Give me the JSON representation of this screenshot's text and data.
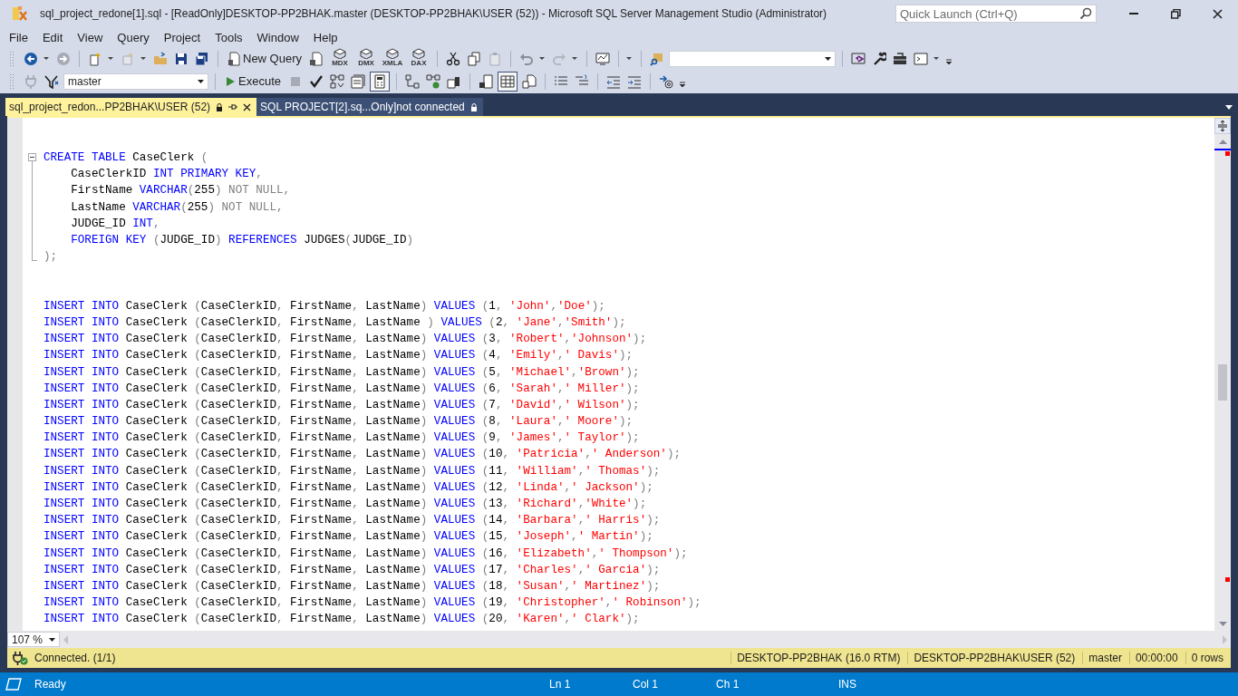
{
  "window": {
    "title": "sql_project_redone[1].sql -  [ReadOnly]DESKTOP-PP2BHAK.master (DESKTOP-PP2BHAK\\USER (52)) - Microsoft SQL Server Management Studio (Administrator)"
  },
  "quick_launch": {
    "placeholder": "Quick Launch (Ctrl+Q)"
  },
  "menu": [
    "File",
    "Edit",
    "View",
    "Query",
    "Project",
    "Tools",
    "Window",
    "Help"
  ],
  "toolbar": {
    "new_query": "New Query",
    "query_types": [
      "MDX",
      "DMX",
      "XMLA",
      "DAX"
    ],
    "database": "master",
    "execute": "Execute"
  },
  "tabs": [
    {
      "label": "sql_project_redon...PP2BHAK\\USER (52)",
      "selected": true
    },
    {
      "label": "SQL PROJECT[2].sq...Only]not connected",
      "selected": false
    }
  ],
  "editor": {
    "lines": [
      {
        "kind": "fold_start",
        "tokens": [
          {
            "kind": "keyword",
            "text": "CREATE TABLE"
          },
          {
            "kind": "name",
            "text": " CaseClerk "
          },
          {
            "kind": "punct",
            "text": "("
          }
        ]
      },
      {
        "kind": "fold_inside",
        "tokens": [
          {
            "kind": "name",
            "text": "    CaseClerkID "
          },
          {
            "kind": "keyword",
            "text": "INT PRIMARY KEY"
          },
          {
            "kind": "punct",
            "text": ","
          }
        ]
      },
      {
        "kind": "fold_inside",
        "tokens": [
          {
            "kind": "name",
            "text": "    FirstName "
          },
          {
            "kind": "keyword",
            "text": "VARCHAR"
          },
          {
            "kind": "punct",
            "text": "("
          },
          {
            "kind": "name",
            "text": "255"
          },
          {
            "kind": "punct",
            "text": ") NOT NULL,"
          }
        ]
      },
      {
        "kind": "fold_inside",
        "tokens": [
          {
            "kind": "name",
            "text": "    LastName "
          },
          {
            "kind": "keyword",
            "text": "VARCHAR"
          },
          {
            "kind": "punct",
            "text": "("
          },
          {
            "kind": "name",
            "text": "255"
          },
          {
            "kind": "punct",
            "text": ") NOT NULL,"
          }
        ]
      },
      {
        "kind": "fold_inside",
        "tokens": [
          {
            "kind": "name",
            "text": "    JUDGE_ID "
          },
          {
            "kind": "keyword",
            "text": "INT"
          },
          {
            "kind": "punct",
            "text": ","
          }
        ]
      },
      {
        "kind": "fold_inside",
        "tokens": [
          {
            "kind": "keyword",
            "text": "    FOREIGN KEY"
          },
          {
            "kind": "punct",
            "text": " ("
          },
          {
            "kind": "name",
            "text": "JUDGE_ID"
          },
          {
            "kind": "punct",
            "text": ") "
          },
          {
            "kind": "keyword",
            "text": "REFERENCES"
          },
          {
            "kind": "name",
            "text": " JUDGES"
          },
          {
            "kind": "punct",
            "text": "("
          },
          {
            "kind": "name",
            "text": "JUDGE_ID"
          },
          {
            "kind": "punct",
            "text": ")"
          }
        ]
      },
      {
        "kind": "fold_end",
        "tokens": [
          {
            "kind": "punct",
            "text": ");"
          }
        ]
      },
      {
        "kind": "blank"
      },
      {
        "kind": "blank"
      },
      {
        "kind": "code",
        "tokens": [
          {
            "kind": "keyword",
            "text": "INSERT INTO"
          },
          {
            "kind": "name",
            "text": " CaseClerk "
          },
          {
            "kind": "punct",
            "text": "("
          },
          {
            "kind": "name",
            "text": "CaseClerkID"
          },
          {
            "kind": "punct",
            "text": ", "
          },
          {
            "kind": "name",
            "text": "FirstName"
          },
          {
            "kind": "punct",
            "text": ", "
          },
          {
            "kind": "name",
            "text": "LastName"
          },
          {
            "kind": "punct",
            "text": ") "
          },
          {
            "kind": "keyword",
            "text": "VALUES"
          },
          {
            "kind": "punct",
            "text": " ("
          },
          {
            "kind": "name",
            "text": "1"
          },
          {
            "kind": "punct",
            "text": ", "
          },
          {
            "kind": "string",
            "text": "'John'"
          },
          {
            "kind": "punct",
            "text": ","
          },
          {
            "kind": "string",
            "text": "'Doe'"
          },
          {
            "kind": "punct",
            "text": ");"
          }
        ]
      },
      {
        "kind": "code",
        "tokens": [
          {
            "kind": "keyword",
            "text": "INSERT INTO"
          },
          {
            "kind": "name",
            "text": " CaseClerk "
          },
          {
            "kind": "punct",
            "text": "("
          },
          {
            "kind": "name",
            "text": "CaseClerkID"
          },
          {
            "kind": "punct",
            "text": ", "
          },
          {
            "kind": "name",
            "text": "FirstName"
          },
          {
            "kind": "punct",
            "text": ", "
          },
          {
            "kind": "name",
            "text": "LastName"
          },
          {
            "kind": "punct",
            "text": " ) "
          },
          {
            "kind": "keyword",
            "text": "VALUES"
          },
          {
            "kind": "punct",
            "text": " ("
          },
          {
            "kind": "name",
            "text": "2"
          },
          {
            "kind": "punct",
            "text": ", "
          },
          {
            "kind": "string",
            "text": "'Jane'"
          },
          {
            "kind": "punct",
            "text": ","
          },
          {
            "kind": "string",
            "text": "'Smith'"
          },
          {
            "kind": "punct",
            "text": ");"
          }
        ]
      },
      {
        "kind": "code",
        "tokens": [
          {
            "kind": "keyword",
            "text": "INSERT INTO"
          },
          {
            "kind": "name",
            "text": " CaseClerk "
          },
          {
            "kind": "punct",
            "text": "("
          },
          {
            "kind": "name",
            "text": "CaseClerkID"
          },
          {
            "kind": "punct",
            "text": ", "
          },
          {
            "kind": "name",
            "text": "FirstName"
          },
          {
            "kind": "punct",
            "text": ", "
          },
          {
            "kind": "name",
            "text": "LastName"
          },
          {
            "kind": "punct",
            "text": ") "
          },
          {
            "kind": "keyword",
            "text": "VALUES"
          },
          {
            "kind": "punct",
            "text": " ("
          },
          {
            "kind": "name",
            "text": "3"
          },
          {
            "kind": "punct",
            "text": ", "
          },
          {
            "kind": "string",
            "text": "'Robert'"
          },
          {
            "kind": "punct",
            "text": ","
          },
          {
            "kind": "string",
            "text": "'Johnson'"
          },
          {
            "kind": "punct",
            "text": ");"
          }
        ]
      },
      {
        "kind": "code",
        "tokens": [
          {
            "kind": "keyword",
            "text": "INSERT INTO"
          },
          {
            "kind": "name",
            "text": " CaseClerk "
          },
          {
            "kind": "punct",
            "text": "("
          },
          {
            "kind": "name",
            "text": "CaseClerkID"
          },
          {
            "kind": "punct",
            "text": ", "
          },
          {
            "kind": "name",
            "text": "FirstName"
          },
          {
            "kind": "punct",
            "text": ", "
          },
          {
            "kind": "name",
            "text": "LastName"
          },
          {
            "kind": "punct",
            "text": ") "
          },
          {
            "kind": "keyword",
            "text": "VALUES"
          },
          {
            "kind": "punct",
            "text": " ("
          },
          {
            "kind": "name",
            "text": "4"
          },
          {
            "kind": "punct",
            "text": ", "
          },
          {
            "kind": "string",
            "text": "'Emily'"
          },
          {
            "kind": "punct",
            "text": ","
          },
          {
            "kind": "string",
            "text": "' Davis'"
          },
          {
            "kind": "punct",
            "text": ");"
          }
        ]
      },
      {
        "kind": "code",
        "tokens": [
          {
            "kind": "keyword",
            "text": "INSERT INTO"
          },
          {
            "kind": "name",
            "text": " CaseClerk "
          },
          {
            "kind": "punct",
            "text": "("
          },
          {
            "kind": "name",
            "text": "CaseClerkID"
          },
          {
            "kind": "punct",
            "text": ", "
          },
          {
            "kind": "name",
            "text": "FirstName"
          },
          {
            "kind": "punct",
            "text": ", "
          },
          {
            "kind": "name",
            "text": "LastName"
          },
          {
            "kind": "punct",
            "text": ") "
          },
          {
            "kind": "keyword",
            "text": "VALUES"
          },
          {
            "kind": "punct",
            "text": " ("
          },
          {
            "kind": "name",
            "text": "5"
          },
          {
            "kind": "punct",
            "text": ", "
          },
          {
            "kind": "string",
            "text": "'Michael'"
          },
          {
            "kind": "punct",
            "text": ","
          },
          {
            "kind": "string",
            "text": "'Brown'"
          },
          {
            "kind": "punct",
            "text": ");"
          }
        ]
      },
      {
        "kind": "code",
        "tokens": [
          {
            "kind": "keyword",
            "text": "INSERT INTO"
          },
          {
            "kind": "name",
            "text": " CaseClerk "
          },
          {
            "kind": "punct",
            "text": "("
          },
          {
            "kind": "name",
            "text": "CaseClerkID"
          },
          {
            "kind": "punct",
            "text": ", "
          },
          {
            "kind": "name",
            "text": "FirstName"
          },
          {
            "kind": "punct",
            "text": ", "
          },
          {
            "kind": "name",
            "text": "LastName"
          },
          {
            "kind": "punct",
            "text": ") "
          },
          {
            "kind": "keyword",
            "text": "VALUES"
          },
          {
            "kind": "punct",
            "text": " ("
          },
          {
            "kind": "name",
            "text": "6"
          },
          {
            "kind": "punct",
            "text": ", "
          },
          {
            "kind": "string",
            "text": "'Sarah'"
          },
          {
            "kind": "punct",
            "text": ","
          },
          {
            "kind": "string",
            "text": "' Miller'"
          },
          {
            "kind": "punct",
            "text": ");"
          }
        ]
      },
      {
        "kind": "code",
        "tokens": [
          {
            "kind": "keyword",
            "text": "INSERT INTO"
          },
          {
            "kind": "name",
            "text": " CaseClerk "
          },
          {
            "kind": "punct",
            "text": "("
          },
          {
            "kind": "name",
            "text": "CaseClerkID"
          },
          {
            "kind": "punct",
            "text": ", "
          },
          {
            "kind": "name",
            "text": "FirstName"
          },
          {
            "kind": "punct",
            "text": ", "
          },
          {
            "kind": "name",
            "text": "LastName"
          },
          {
            "kind": "punct",
            "text": ") "
          },
          {
            "kind": "keyword",
            "text": "VALUES"
          },
          {
            "kind": "punct",
            "text": " ("
          },
          {
            "kind": "name",
            "text": "7"
          },
          {
            "kind": "punct",
            "text": ", "
          },
          {
            "kind": "string",
            "text": "'David'"
          },
          {
            "kind": "punct",
            "text": ","
          },
          {
            "kind": "string",
            "text": "' Wilson'"
          },
          {
            "kind": "punct",
            "text": ");"
          }
        ]
      },
      {
        "kind": "code",
        "tokens": [
          {
            "kind": "keyword",
            "text": "INSERT INTO"
          },
          {
            "kind": "name",
            "text": " CaseClerk "
          },
          {
            "kind": "punct",
            "text": "("
          },
          {
            "kind": "name",
            "text": "CaseClerkID"
          },
          {
            "kind": "punct",
            "text": ", "
          },
          {
            "kind": "name",
            "text": "FirstName"
          },
          {
            "kind": "punct",
            "text": ", "
          },
          {
            "kind": "name",
            "text": "LastName"
          },
          {
            "kind": "punct",
            "text": ") "
          },
          {
            "kind": "keyword",
            "text": "VALUES"
          },
          {
            "kind": "punct",
            "text": " ("
          },
          {
            "kind": "name",
            "text": "8"
          },
          {
            "kind": "punct",
            "text": ", "
          },
          {
            "kind": "string",
            "text": "'Laura'"
          },
          {
            "kind": "punct",
            "text": ","
          },
          {
            "kind": "string",
            "text": "' Moore'"
          },
          {
            "kind": "punct",
            "text": ");"
          }
        ]
      },
      {
        "kind": "code",
        "tokens": [
          {
            "kind": "keyword",
            "text": "INSERT INTO"
          },
          {
            "kind": "name",
            "text": " CaseClerk "
          },
          {
            "kind": "punct",
            "text": "("
          },
          {
            "kind": "name",
            "text": "CaseClerkID"
          },
          {
            "kind": "punct",
            "text": ", "
          },
          {
            "kind": "name",
            "text": "FirstName"
          },
          {
            "kind": "punct",
            "text": ", "
          },
          {
            "kind": "name",
            "text": "LastName"
          },
          {
            "kind": "punct",
            "text": ") "
          },
          {
            "kind": "keyword",
            "text": "VALUES"
          },
          {
            "kind": "punct",
            "text": " ("
          },
          {
            "kind": "name",
            "text": "9"
          },
          {
            "kind": "punct",
            "text": ", "
          },
          {
            "kind": "string",
            "text": "'James'"
          },
          {
            "kind": "punct",
            "text": ","
          },
          {
            "kind": "string",
            "text": "' Taylor'"
          },
          {
            "kind": "punct",
            "text": ");"
          }
        ]
      },
      {
        "kind": "code",
        "tokens": [
          {
            "kind": "keyword",
            "text": "INSERT INTO"
          },
          {
            "kind": "name",
            "text": " CaseClerk "
          },
          {
            "kind": "punct",
            "text": "("
          },
          {
            "kind": "name",
            "text": "CaseClerkID"
          },
          {
            "kind": "punct",
            "text": ", "
          },
          {
            "kind": "name",
            "text": "FirstName"
          },
          {
            "kind": "punct",
            "text": ", "
          },
          {
            "kind": "name",
            "text": "LastName"
          },
          {
            "kind": "punct",
            "text": ") "
          },
          {
            "kind": "keyword",
            "text": "VALUES"
          },
          {
            "kind": "punct",
            "text": " ("
          },
          {
            "kind": "name",
            "text": "10"
          },
          {
            "kind": "punct",
            "text": ", "
          },
          {
            "kind": "string",
            "text": "'Patricia'"
          },
          {
            "kind": "punct",
            "text": ","
          },
          {
            "kind": "string",
            "text": "' Anderson'"
          },
          {
            "kind": "punct",
            "text": ");"
          }
        ]
      },
      {
        "kind": "code",
        "tokens": [
          {
            "kind": "keyword",
            "text": "INSERT INTO"
          },
          {
            "kind": "name",
            "text": " CaseClerk "
          },
          {
            "kind": "punct",
            "text": "("
          },
          {
            "kind": "name",
            "text": "CaseClerkID"
          },
          {
            "kind": "punct",
            "text": ", "
          },
          {
            "kind": "name",
            "text": "FirstName"
          },
          {
            "kind": "punct",
            "text": ", "
          },
          {
            "kind": "name",
            "text": "LastName"
          },
          {
            "kind": "punct",
            "text": ") "
          },
          {
            "kind": "keyword",
            "text": "VALUES"
          },
          {
            "kind": "punct",
            "text": " ("
          },
          {
            "kind": "name",
            "text": "11"
          },
          {
            "kind": "punct",
            "text": ", "
          },
          {
            "kind": "string",
            "text": "'William'"
          },
          {
            "kind": "punct",
            "text": ","
          },
          {
            "kind": "string",
            "text": "' Thomas'"
          },
          {
            "kind": "punct",
            "text": ");"
          }
        ]
      },
      {
        "kind": "code",
        "tokens": [
          {
            "kind": "keyword",
            "text": "INSERT INTO"
          },
          {
            "kind": "name",
            "text": " CaseClerk "
          },
          {
            "kind": "punct",
            "text": "("
          },
          {
            "kind": "name",
            "text": "CaseClerkID"
          },
          {
            "kind": "punct",
            "text": ", "
          },
          {
            "kind": "name",
            "text": "FirstName"
          },
          {
            "kind": "punct",
            "text": ", "
          },
          {
            "kind": "name",
            "text": "LastName"
          },
          {
            "kind": "punct",
            "text": ") "
          },
          {
            "kind": "keyword",
            "text": "VALUES"
          },
          {
            "kind": "punct",
            "text": " ("
          },
          {
            "kind": "name",
            "text": "12"
          },
          {
            "kind": "punct",
            "text": ", "
          },
          {
            "kind": "string",
            "text": "'Linda'"
          },
          {
            "kind": "punct",
            "text": ","
          },
          {
            "kind": "string",
            "text": "' Jackson'"
          },
          {
            "kind": "punct",
            "text": ");"
          }
        ]
      },
      {
        "kind": "code",
        "tokens": [
          {
            "kind": "keyword",
            "text": "INSERT INTO"
          },
          {
            "kind": "name",
            "text": " CaseClerk "
          },
          {
            "kind": "punct",
            "text": "("
          },
          {
            "kind": "name",
            "text": "CaseClerkID"
          },
          {
            "kind": "punct",
            "text": ", "
          },
          {
            "kind": "name",
            "text": "FirstName"
          },
          {
            "kind": "punct",
            "text": ", "
          },
          {
            "kind": "name",
            "text": "LastName"
          },
          {
            "kind": "punct",
            "text": ") "
          },
          {
            "kind": "keyword",
            "text": "VALUES"
          },
          {
            "kind": "punct",
            "text": " ("
          },
          {
            "kind": "name",
            "text": "13"
          },
          {
            "kind": "punct",
            "text": ", "
          },
          {
            "kind": "string",
            "text": "'Richard'"
          },
          {
            "kind": "punct",
            "text": ","
          },
          {
            "kind": "string",
            "text": "'White'"
          },
          {
            "kind": "punct",
            "text": ");"
          }
        ]
      },
      {
        "kind": "code",
        "tokens": [
          {
            "kind": "keyword",
            "text": "INSERT INTO"
          },
          {
            "kind": "name",
            "text": " CaseClerk "
          },
          {
            "kind": "punct",
            "text": "("
          },
          {
            "kind": "name",
            "text": "CaseClerkID"
          },
          {
            "kind": "punct",
            "text": ", "
          },
          {
            "kind": "name",
            "text": "FirstName"
          },
          {
            "kind": "punct",
            "text": ", "
          },
          {
            "kind": "name",
            "text": "LastName"
          },
          {
            "kind": "punct",
            "text": ") "
          },
          {
            "kind": "keyword",
            "text": "VALUES"
          },
          {
            "kind": "punct",
            "text": " ("
          },
          {
            "kind": "name",
            "text": "14"
          },
          {
            "kind": "punct",
            "text": ", "
          },
          {
            "kind": "string",
            "text": "'Barbara'"
          },
          {
            "kind": "punct",
            "text": ","
          },
          {
            "kind": "string",
            "text": "' Harris'"
          },
          {
            "kind": "punct",
            "text": ");"
          }
        ]
      },
      {
        "kind": "code",
        "tokens": [
          {
            "kind": "keyword",
            "text": "INSERT INTO"
          },
          {
            "kind": "name",
            "text": " CaseClerk "
          },
          {
            "kind": "punct",
            "text": "("
          },
          {
            "kind": "name",
            "text": "CaseClerkID"
          },
          {
            "kind": "punct",
            "text": ", "
          },
          {
            "kind": "name",
            "text": "FirstName"
          },
          {
            "kind": "punct",
            "text": ", "
          },
          {
            "kind": "name",
            "text": "LastName"
          },
          {
            "kind": "punct",
            "text": ") "
          },
          {
            "kind": "keyword",
            "text": "VALUES"
          },
          {
            "kind": "punct",
            "text": " ("
          },
          {
            "kind": "name",
            "text": "15"
          },
          {
            "kind": "punct",
            "text": ", "
          },
          {
            "kind": "string",
            "text": "'Joseph'"
          },
          {
            "kind": "punct",
            "text": ","
          },
          {
            "kind": "string",
            "text": "' Martin'"
          },
          {
            "kind": "punct",
            "text": ");"
          }
        ]
      },
      {
        "kind": "code",
        "tokens": [
          {
            "kind": "keyword",
            "text": "INSERT INTO"
          },
          {
            "kind": "name",
            "text": " CaseClerk "
          },
          {
            "kind": "punct",
            "text": "("
          },
          {
            "kind": "name",
            "text": "CaseClerkID"
          },
          {
            "kind": "punct",
            "text": ", "
          },
          {
            "kind": "name",
            "text": "FirstName"
          },
          {
            "kind": "punct",
            "text": ", "
          },
          {
            "kind": "name",
            "text": "LastName"
          },
          {
            "kind": "punct",
            "text": ") "
          },
          {
            "kind": "keyword",
            "text": "VALUES"
          },
          {
            "kind": "punct",
            "text": " ("
          },
          {
            "kind": "name",
            "text": "16"
          },
          {
            "kind": "punct",
            "text": ", "
          },
          {
            "kind": "string",
            "text": "'Elizabeth'"
          },
          {
            "kind": "punct",
            "text": ","
          },
          {
            "kind": "string",
            "text": "' Thompson'"
          },
          {
            "kind": "punct",
            "text": ");"
          }
        ]
      },
      {
        "kind": "code",
        "tokens": [
          {
            "kind": "keyword",
            "text": "INSERT INTO"
          },
          {
            "kind": "name",
            "text": " CaseClerk "
          },
          {
            "kind": "punct",
            "text": "("
          },
          {
            "kind": "name",
            "text": "CaseClerkID"
          },
          {
            "kind": "punct",
            "text": ", "
          },
          {
            "kind": "name",
            "text": "FirstName"
          },
          {
            "kind": "punct",
            "text": ", "
          },
          {
            "kind": "name",
            "text": "LastName"
          },
          {
            "kind": "punct",
            "text": ") "
          },
          {
            "kind": "keyword",
            "text": "VALUES"
          },
          {
            "kind": "punct",
            "text": " ("
          },
          {
            "kind": "name",
            "text": "17"
          },
          {
            "kind": "punct",
            "text": ", "
          },
          {
            "kind": "string",
            "text": "'Charles'"
          },
          {
            "kind": "punct",
            "text": ","
          },
          {
            "kind": "string",
            "text": "' Garcia'"
          },
          {
            "kind": "punct",
            "text": ");"
          }
        ]
      },
      {
        "kind": "code",
        "tokens": [
          {
            "kind": "keyword",
            "text": "INSERT INTO"
          },
          {
            "kind": "name",
            "text": " CaseClerk "
          },
          {
            "kind": "punct",
            "text": "("
          },
          {
            "kind": "name",
            "text": "CaseClerkID"
          },
          {
            "kind": "punct",
            "text": ", "
          },
          {
            "kind": "name",
            "text": "FirstName"
          },
          {
            "kind": "punct",
            "text": ", "
          },
          {
            "kind": "name",
            "text": "LastName"
          },
          {
            "kind": "punct",
            "text": ") "
          },
          {
            "kind": "keyword",
            "text": "VALUES"
          },
          {
            "kind": "punct",
            "text": " ("
          },
          {
            "kind": "name",
            "text": "18"
          },
          {
            "kind": "punct",
            "text": ", "
          },
          {
            "kind": "string",
            "text": "'Susan'"
          },
          {
            "kind": "punct",
            "text": ","
          },
          {
            "kind": "string",
            "text": "' Martinez'"
          },
          {
            "kind": "punct",
            "text": ");"
          }
        ]
      },
      {
        "kind": "code",
        "tokens": [
          {
            "kind": "keyword",
            "text": "INSERT INTO"
          },
          {
            "kind": "name",
            "text": " CaseClerk "
          },
          {
            "kind": "punct",
            "text": "("
          },
          {
            "kind": "name",
            "text": "CaseClerkID"
          },
          {
            "kind": "punct",
            "text": ", "
          },
          {
            "kind": "name",
            "text": "FirstName"
          },
          {
            "kind": "punct",
            "text": ", "
          },
          {
            "kind": "name",
            "text": "LastName"
          },
          {
            "kind": "punct",
            "text": ") "
          },
          {
            "kind": "keyword",
            "text": "VALUES"
          },
          {
            "kind": "punct",
            "text": " ("
          },
          {
            "kind": "name",
            "text": "19"
          },
          {
            "kind": "punct",
            "text": ", "
          },
          {
            "kind": "string",
            "text": "'Christopher'"
          },
          {
            "kind": "punct",
            "text": ","
          },
          {
            "kind": "string",
            "text": "' Robinson'"
          },
          {
            "kind": "punct",
            "text": ");"
          }
        ]
      },
      {
        "kind": "code",
        "tokens": [
          {
            "kind": "keyword",
            "text": "INSERT INTO"
          },
          {
            "kind": "name",
            "text": " CaseClerk "
          },
          {
            "kind": "punct",
            "text": "("
          },
          {
            "kind": "name",
            "text": "CaseClerkID"
          },
          {
            "kind": "punct",
            "text": ", "
          },
          {
            "kind": "name",
            "text": "FirstName"
          },
          {
            "kind": "punct",
            "text": ", "
          },
          {
            "kind": "name",
            "text": "LastName"
          },
          {
            "kind": "punct",
            "text": ") "
          },
          {
            "kind": "keyword",
            "text": "VALUES"
          },
          {
            "kind": "punct",
            "text": " ("
          },
          {
            "kind": "name",
            "text": "20"
          },
          {
            "kind": "punct",
            "text": ", "
          },
          {
            "kind": "string",
            "text": "'Karen'"
          },
          {
            "kind": "punct",
            "text": ","
          },
          {
            "kind": "string",
            "text": "' Clark'"
          },
          {
            "kind": "punct",
            "text": ");"
          }
        ]
      }
    ]
  },
  "zoom": "107 %",
  "query_status": {
    "message": "Connected. (1/1)",
    "server": "DESKTOP-PP2BHAK (16.0 RTM)",
    "login": "DESKTOP-PP2BHAK\\USER (52)",
    "database": "master",
    "elapsed": "00:00:00",
    "rows": "0 rows"
  },
  "status_bar": {
    "state": "Ready",
    "line": "Ln 1",
    "column": "Col 1",
    "char": "Ch 1",
    "mode": "INS"
  }
}
